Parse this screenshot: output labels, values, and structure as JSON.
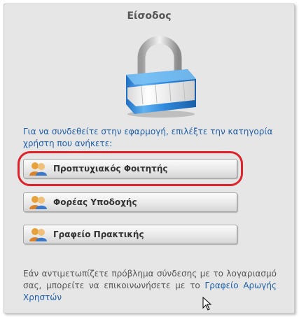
{
  "panel": {
    "title": "Είσοδος"
  },
  "icons": {
    "lock": "padlock-icon",
    "user_group": "users-icon",
    "cursor": "mouse-pointer-icon"
  },
  "colors": {
    "link": "#1f5fa8",
    "highlight": "#e0232a",
    "panel_bg": "#e6e6e6"
  },
  "instruction": "Για να συνδεθείτε στην εφαρμογή, επιλέξτε την κατηγορία χρήστη που ανήκετε:",
  "buttons": [
    {
      "label": "Προπτυχιακός Φοιτητής"
    },
    {
      "label": "Φορέας Υποδοχής"
    },
    {
      "label": "Γραφείο Πρακτικής"
    }
  ],
  "help": {
    "text": "Εάν αντιμετωπίζετε πρόβλημα σύνδεσης με το λογαριασμό σας, μπορείτε να επικοινωνήσετε με το",
    "link": "Γραφείο Αρωγής Χρηστών"
  }
}
